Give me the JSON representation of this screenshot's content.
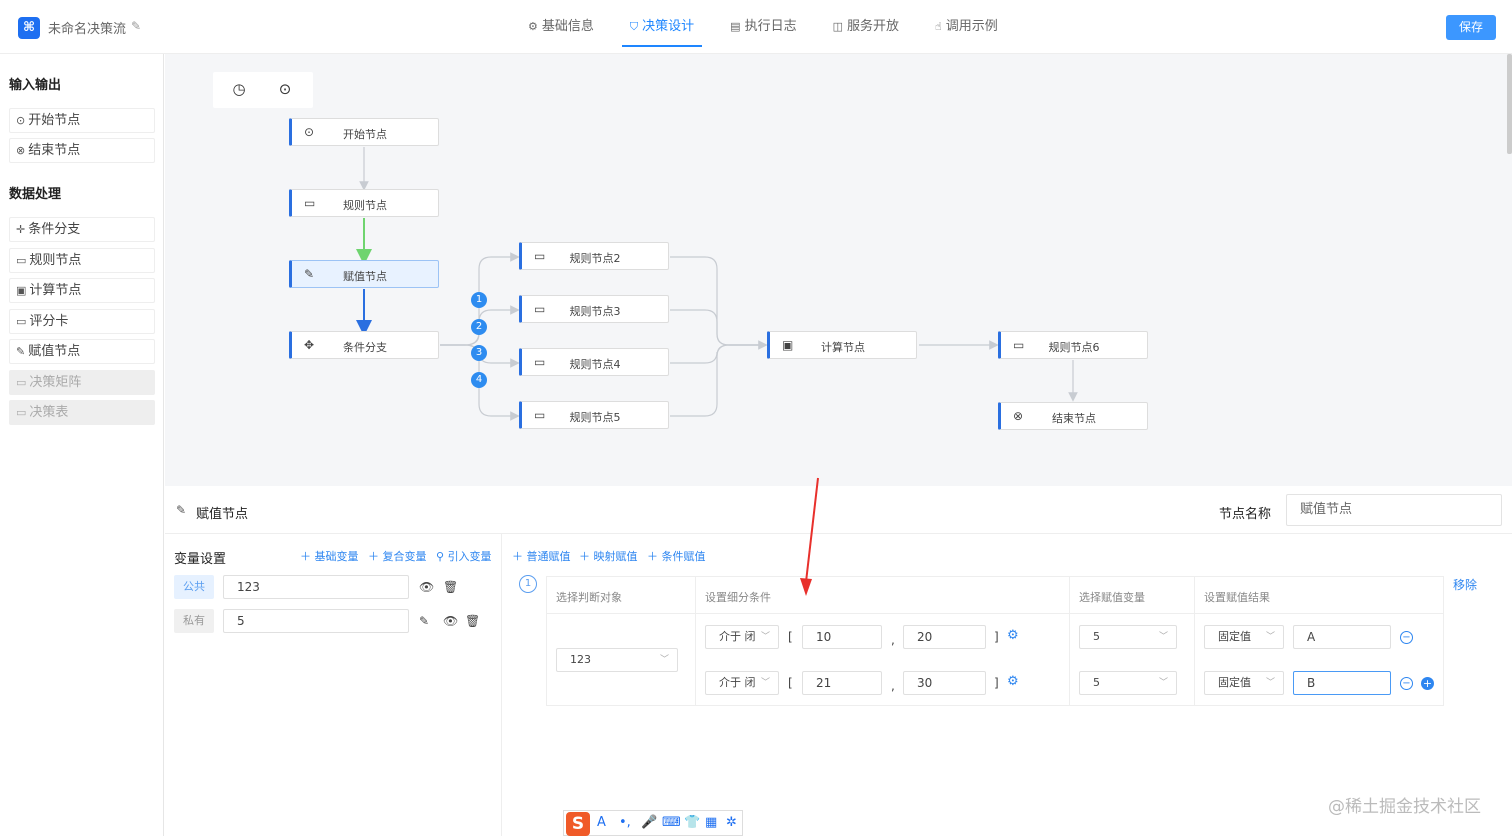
{
  "header": {
    "title": "未命名决策流",
    "tabs": [
      {
        "label": "基础信息",
        "icon": "gear-icon"
      },
      {
        "label": "决策设计",
        "icon": "flow-icon"
      },
      {
        "label": "执行日志",
        "icon": "document-icon"
      },
      {
        "label": "服务开放",
        "icon": "book-icon"
      },
      {
        "label": "调用示例",
        "icon": "hand-icon"
      }
    ],
    "active_tab": "决策设计",
    "save_label": "保存"
  },
  "sidebar": {
    "io_title": "输入输出",
    "io_items": [
      "开始节点",
      "结束节点"
    ],
    "data_title": "数据处理",
    "data_items": [
      "条件分支",
      "规则节点",
      "计算节点",
      "评分卡",
      "赋值节点",
      "决策矩阵",
      "决策表"
    ],
    "disabled_items": [
      "决策矩阵",
      "决策表"
    ]
  },
  "canvas": {
    "nodes": {
      "start": "开始节点",
      "rule1": "规则节点",
      "assign": "赋值节点",
      "branch": "条件分支",
      "rule2": "规则节点2",
      "rule3": "规则节点3",
      "rule4": "规则节点4",
      "rule5": "规则节点5",
      "calc": "计算节点",
      "rule6": "规则节点6",
      "end": "结束节点"
    },
    "branch_badges": [
      "1",
      "2",
      "3",
      "4"
    ],
    "colors": {
      "accent": "#2a6fe0",
      "green_link": "#6fd46f",
      "blue_link": "#2a6fe0",
      "link": "#c8ccd2",
      "annotation_arrow": "#e8302c"
    }
  },
  "panel": {
    "title": "赋值节点",
    "node_name_label": "节点名称",
    "node_name_value": "赋值节点",
    "variables": {
      "title": "变量设置",
      "links": [
        "基础变量",
        "复合变量",
        "引入变量"
      ],
      "rows": [
        {
          "tag": "公共",
          "value": "123"
        },
        {
          "tag": "私有",
          "value": "5"
        }
      ]
    },
    "assign_links": [
      "普通赋值",
      "映射赋值",
      "条件赋值"
    ],
    "rule_index": "1",
    "remove_label": "移除",
    "grid": {
      "headers": [
        "选择判断对象",
        "设置细分条件",
        "选择赋值变量",
        "设置赋值结果"
      ],
      "object_value": "123",
      "rows": [
        {
          "op": "介于 闭",
          "lb": "[",
          "low": "10",
          "comma": ",",
          "high": "20",
          "rb": "]",
          "var": "5",
          "result_type": "固定值",
          "result": "A"
        },
        {
          "op": "介于 闭",
          "lb": "[",
          "low": "21",
          "comma": ",",
          "high": "30",
          "rb": "]",
          "var": "5",
          "result_type": "固定值",
          "result": "B"
        }
      ]
    }
  },
  "watermark": "@稀土掘金技术社区"
}
